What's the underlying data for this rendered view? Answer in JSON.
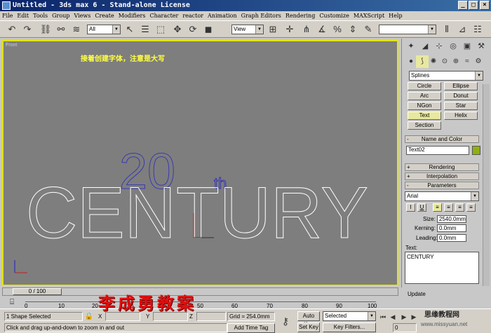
{
  "window": {
    "title": "Untitled - 3ds max 6 - Stand-alone License"
  },
  "menu": [
    "File",
    "Edit",
    "Tools",
    "Group",
    "Views",
    "Create",
    "Modifiers",
    "Character",
    "reactor",
    "Animation",
    "Graph Editors",
    "Rendering",
    "Customize",
    "MAXScript",
    "Help"
  ],
  "toolbar": {
    "filter": "All",
    "refcoord": "View"
  },
  "viewport": {
    "label": "Front",
    "note": "接着创建字体，注意是大写",
    "text_main": "CENTURY",
    "text_20": "20",
    "text_th": "th"
  },
  "panel": {
    "category": "Splines",
    "object_types": [
      "Circle",
      "Ellipse",
      "Arc",
      "Donut",
      "NGon",
      "Star",
      "Text",
      "Helix",
      "Section"
    ],
    "name_color_title": "Name and Color",
    "object_name": "Text02",
    "object_color": "#90b010",
    "rollouts": {
      "rendering": "Rendering",
      "interpolation": "Interpolation",
      "parameters": "Parameters"
    },
    "font": "Arial",
    "style_buttons": [
      "I",
      "U"
    ],
    "size_label": "Size:",
    "size_value": "2540.0mm",
    "kerning_label": "Kerning:",
    "kerning_value": "0.0mm",
    "leading_label": "Leading:",
    "leading_value": "0.0mm",
    "text_label": "Text:",
    "text_value": "CENTURY",
    "update_group": "Update",
    "update_button": "Update"
  },
  "timeline": {
    "position": "0 / 100",
    "ticks": [
      "0",
      "10",
      "20",
      "30",
      "40",
      "50",
      "60",
      "70",
      "80",
      "90",
      "100"
    ]
  },
  "status": {
    "selection": "1 Shape Selected",
    "prompt": "Click and drag up-and-down to zoom in and out",
    "x_label": "X",
    "y_label": "Y",
    "z_label": "Z",
    "grid": "Grid = 254.0mm",
    "add_time_tag": "Add Time Tag",
    "auto_key": "Auto Key",
    "set_key": "Set Key",
    "key_mode": "Selected",
    "key_filters": "Key Filters...",
    "frame": "0"
  },
  "watermark": "李成勇教案",
  "site": {
    "name": "思缘教程网",
    "url": "www.missyuan.net"
  }
}
